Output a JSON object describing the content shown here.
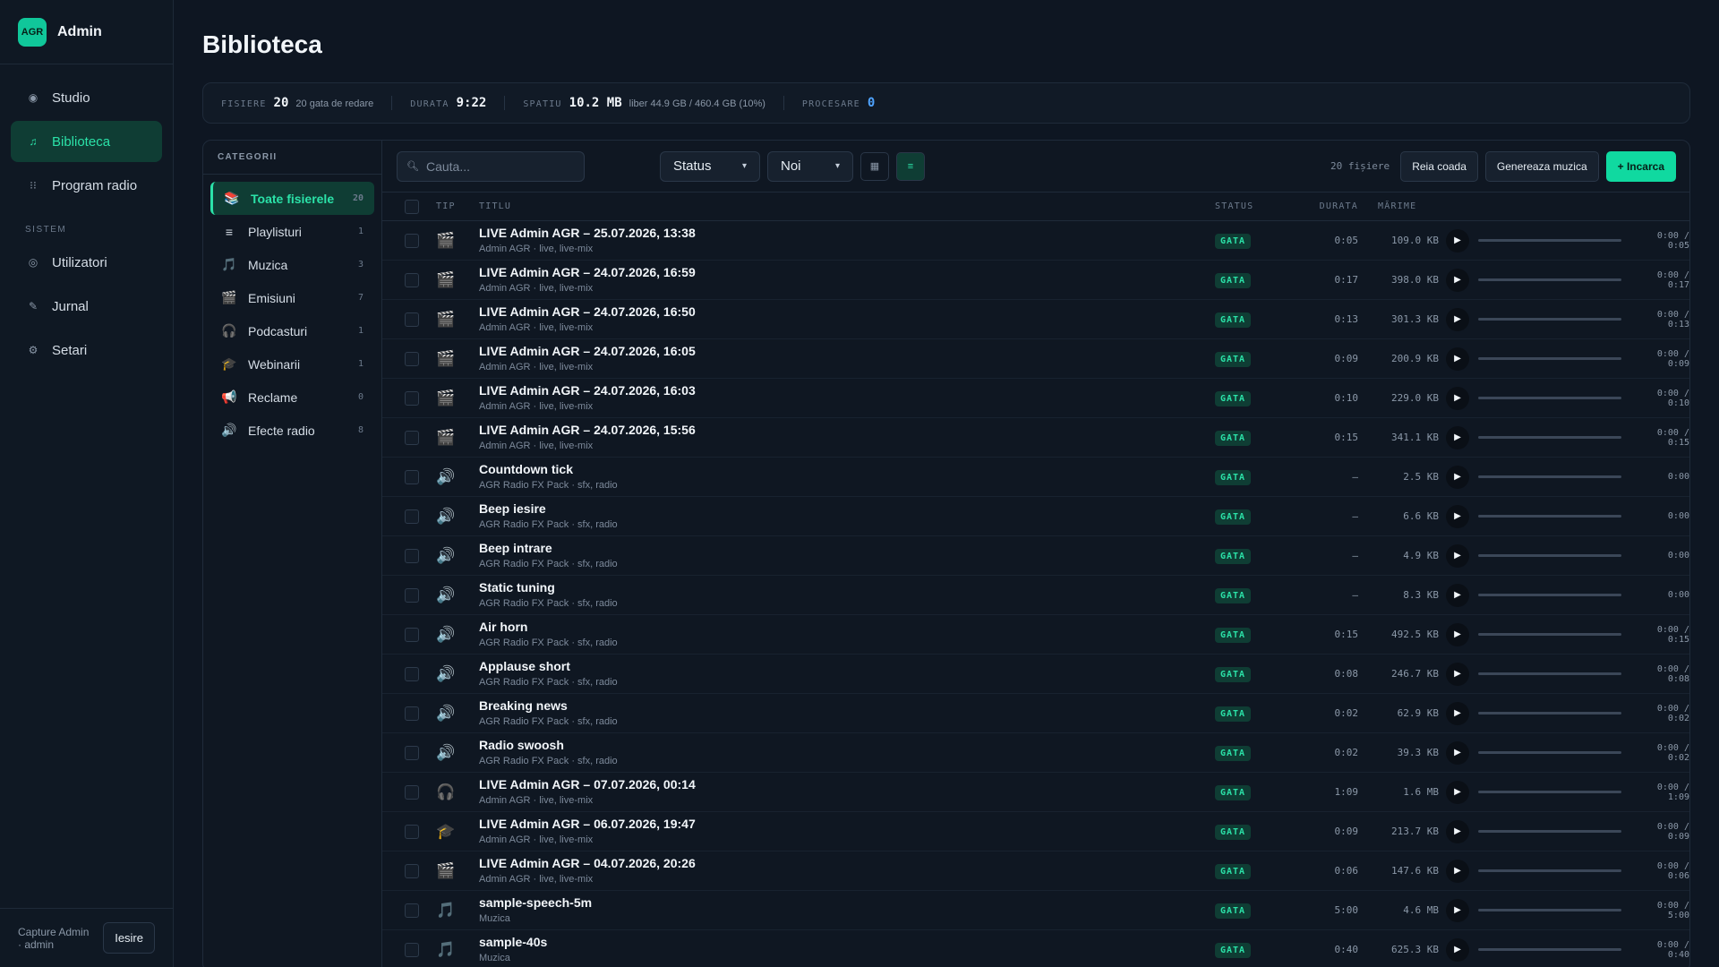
{
  "brand": {
    "logo": "AGR",
    "name": "Admin"
  },
  "nav": {
    "items": [
      {
        "label": "Studio",
        "icon": "◉"
      },
      {
        "label": "Biblioteca",
        "icon": "♫"
      },
      {
        "label": "Program radio",
        "icon": "⁝⁝"
      }
    ],
    "section": "SISTEM",
    "system_items": [
      {
        "label": "Utilizatori",
        "icon": "◎"
      },
      {
        "label": "Jurnal",
        "icon": "✎"
      },
      {
        "label": "Setari",
        "icon": "⚙"
      }
    ]
  },
  "footer": {
    "user": "Capture Admin · admin",
    "logout": "Iesire"
  },
  "page": {
    "title": "Biblioteca"
  },
  "stats": [
    {
      "key": "FISIERE",
      "value": "20",
      "extra": "20 gata de redare"
    },
    {
      "key": "DURATA",
      "value": "9:22",
      "extra": ""
    },
    {
      "key": "SPATIU",
      "value": "10.2 MB",
      "extra": "liber 44.9 GB / 460.4 GB (10%)"
    },
    {
      "key": "PROCESARE",
      "value": "0",
      "extra": ""
    }
  ],
  "categories": {
    "title": "CATEGORII",
    "items": [
      {
        "label": "Toate fisierele",
        "count": "20",
        "icon": "📚"
      },
      {
        "label": "Playlisturi",
        "count": "1",
        "icon": "≡"
      },
      {
        "label": "Muzica",
        "count": "3",
        "icon": "🎵"
      },
      {
        "label": "Emisiuni",
        "count": "7",
        "icon": "🎬"
      },
      {
        "label": "Podcasturi",
        "count": "1",
        "icon": "🎧"
      },
      {
        "label": "Webinarii",
        "count": "1",
        "icon": "🎓"
      },
      {
        "label": "Reclame",
        "count": "0",
        "icon": "📢"
      },
      {
        "label": "Efecte radio",
        "count": "8",
        "icon": "🔊"
      }
    ]
  },
  "toolbar": {
    "search_placeholder": "Cauta...",
    "status_select": "Status",
    "sort_select": "Noi",
    "count_text": "20 fișiere",
    "retry_label": "Reia coada",
    "generate_label": "Genereaza muzica",
    "upload_label": "+ Incarca"
  },
  "table": {
    "headers": {
      "tip": "TIP",
      "title": "TITLU",
      "status": "STATUS",
      "duration": "DURATA",
      "size": "MĂRIME"
    },
    "rows": [
      {
        "icon": "🎬",
        "title": "LIVE Admin AGR – 25.07.2026, 13:38",
        "sub": "Admin AGR · live, live-mix",
        "status": "GATA",
        "dur": "0:05",
        "size": "109.0 KB",
        "time": "0:00 / 0:05"
      },
      {
        "icon": "🎬",
        "title": "LIVE Admin AGR – 24.07.2026, 16:59",
        "sub": "Admin AGR · live, live-mix",
        "status": "GATA",
        "dur": "0:17",
        "size": "398.0 KB",
        "time": "0:00 / 0:17"
      },
      {
        "icon": "🎬",
        "title": "LIVE Admin AGR – 24.07.2026, 16:50",
        "sub": "Admin AGR · live, live-mix",
        "status": "GATA",
        "dur": "0:13",
        "size": "301.3 KB",
        "time": "0:00 / 0:13"
      },
      {
        "icon": "🎬",
        "title": "LIVE Admin AGR – 24.07.2026, 16:05",
        "sub": "Admin AGR · live, live-mix",
        "status": "GATA",
        "dur": "0:09",
        "size": "200.9 KB",
        "time": "0:00 / 0:09"
      },
      {
        "icon": "🎬",
        "title": "LIVE Admin AGR – 24.07.2026, 16:03",
        "sub": "Admin AGR · live, live-mix",
        "status": "GATA",
        "dur": "0:10",
        "size": "229.0 KB",
        "time": "0:00 / 0:10"
      },
      {
        "icon": "🎬",
        "title": "LIVE Admin AGR – 24.07.2026, 15:56",
        "sub": "Admin AGR · live, live-mix",
        "status": "GATA",
        "dur": "0:15",
        "size": "341.1 KB",
        "time": "0:00 / 0:15"
      },
      {
        "icon": "🔊",
        "title": "Countdown tick",
        "sub": "AGR Radio FX Pack · sfx, radio",
        "status": "GATA",
        "dur": "–",
        "size": "2.5 KB",
        "time": "0:00"
      },
      {
        "icon": "🔊",
        "title": "Beep iesire",
        "sub": "AGR Radio FX Pack · sfx, radio",
        "status": "GATA",
        "dur": "–",
        "size": "6.6 KB",
        "time": "0:00"
      },
      {
        "icon": "🔊",
        "title": "Beep intrare",
        "sub": "AGR Radio FX Pack · sfx, radio",
        "status": "GATA",
        "dur": "–",
        "size": "4.9 KB",
        "time": "0:00"
      },
      {
        "icon": "🔊",
        "title": "Static tuning",
        "sub": "AGR Radio FX Pack · sfx, radio",
        "status": "GATA",
        "dur": "–",
        "size": "8.3 KB",
        "time": "0:00"
      },
      {
        "icon": "🔊",
        "title": "Air horn",
        "sub": "AGR Radio FX Pack · sfx, radio",
        "status": "GATA",
        "dur": "0:15",
        "size": "492.5 KB",
        "time": "0:00 / 0:15"
      },
      {
        "icon": "🔊",
        "title": "Applause short",
        "sub": "AGR Radio FX Pack · sfx, radio",
        "status": "GATA",
        "dur": "0:08",
        "size": "246.7 KB",
        "time": "0:00 / 0:08"
      },
      {
        "icon": "🔊",
        "title": "Breaking news",
        "sub": "AGR Radio FX Pack · sfx, radio",
        "status": "GATA",
        "dur": "0:02",
        "size": "62.9 KB",
        "time": "0:00 / 0:02"
      },
      {
        "icon": "🔊",
        "title": "Radio swoosh",
        "sub": "AGR Radio FX Pack · sfx, radio",
        "status": "GATA",
        "dur": "0:02",
        "size": "39.3 KB",
        "time": "0:00 / 0:02"
      },
      {
        "icon": "🎧",
        "title": "LIVE Admin AGR – 07.07.2026, 00:14",
        "sub": "Admin AGR · live, live-mix",
        "status": "GATA",
        "dur": "1:09",
        "size": "1.6 MB",
        "time": "0:00 / 1:09"
      },
      {
        "icon": "🎓",
        "title": "LIVE Admin AGR – 06.07.2026, 19:47",
        "sub": "Admin AGR · live, live-mix",
        "status": "GATA",
        "dur": "0:09",
        "size": "213.7 KB",
        "time": "0:00 / 0:09"
      },
      {
        "icon": "🎬",
        "title": "LIVE Admin AGR – 04.07.2026, 20:26",
        "sub": "Admin AGR · live, live-mix",
        "status": "GATA",
        "dur": "0:06",
        "size": "147.6 KB",
        "time": "0:00 / 0:06"
      },
      {
        "icon": "🎵",
        "title": "sample-speech-5m",
        "sub": "Muzica",
        "status": "GATA",
        "dur": "5:00",
        "size": "4.6 MB",
        "time": "0:00 / 5:00"
      },
      {
        "icon": "🎵",
        "title": "sample-40s",
        "sub": "Muzica",
        "status": "GATA",
        "dur": "0:40",
        "size": "625.3 KB",
        "time": "0:00 / 0:40"
      }
    ]
  },
  "colors": {
    "accent": "#10d9a0",
    "bg": "#0e1622",
    "panel": "#0f1722"
  }
}
